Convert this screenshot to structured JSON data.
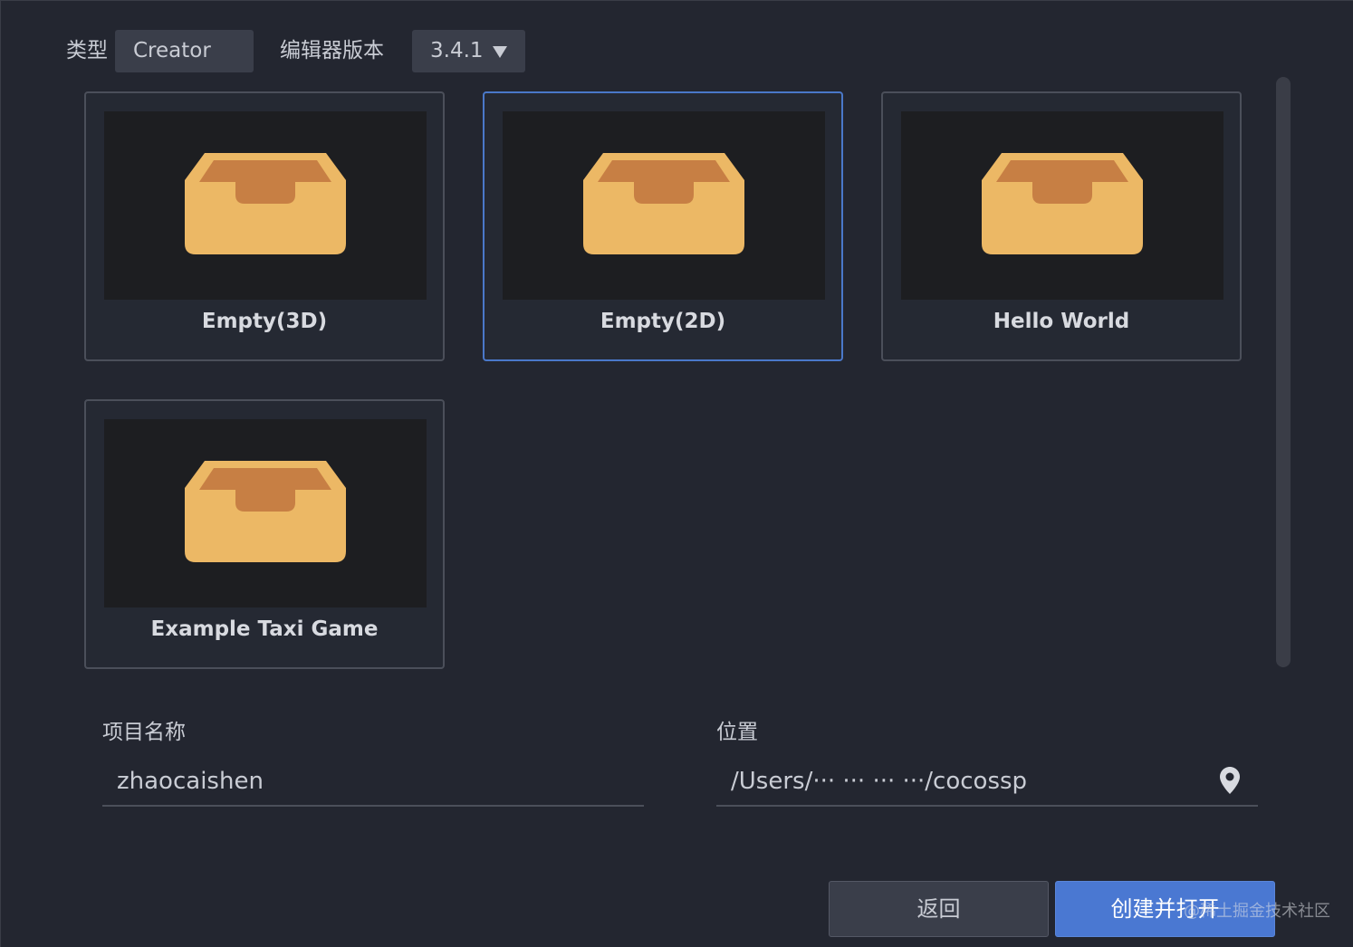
{
  "filters": {
    "type_label": "类型",
    "type_value": "Creator",
    "version_label": "编辑器版本",
    "version_value": "3.4.1"
  },
  "templates": [
    {
      "title": "Empty(3D)",
      "icon": "box-icon",
      "selected": false
    },
    {
      "title": "Empty(2D)",
      "icon": "box-icon",
      "selected": true
    },
    {
      "title": "Hello World",
      "icon": "box-icon",
      "selected": false
    },
    {
      "title": "Example Taxi Game",
      "icon": "box-icon",
      "selected": false
    }
  ],
  "form": {
    "name_label": "项目名称",
    "name_value": "zhaocaishen",
    "location_label": "位置",
    "location_value": "/Users/··· ··· ··· ···/cocossp"
  },
  "buttons": {
    "back_label": "返回",
    "create_label": "创建并打开"
  },
  "watermark": "@稀土掘金技术社区",
  "colors": {
    "background": "#232630",
    "accent": "#4a78d2",
    "box_icon": "#ecb865"
  }
}
